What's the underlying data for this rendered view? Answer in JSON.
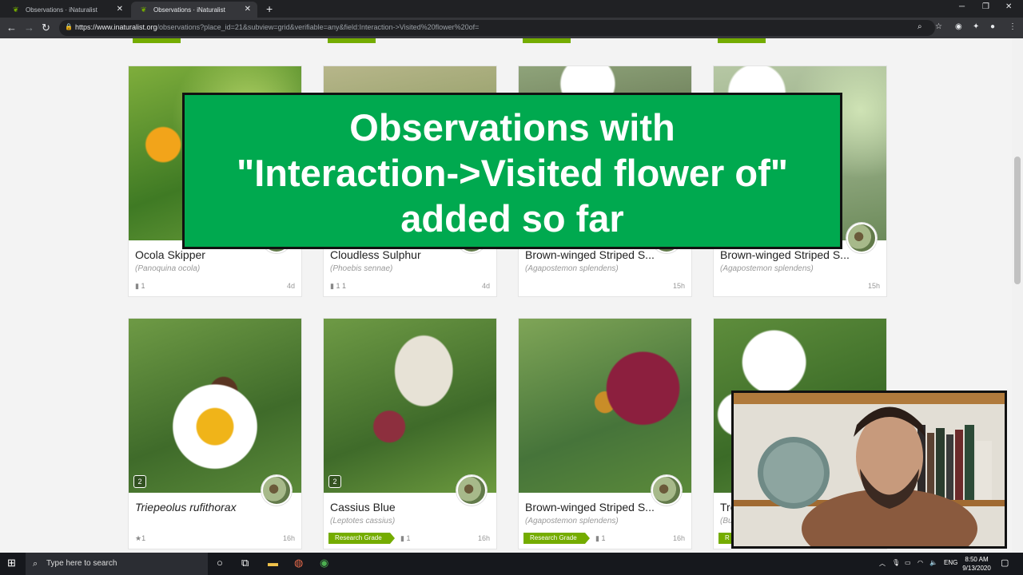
{
  "browser": {
    "tabs": [
      {
        "title": "Observations · iNaturalist",
        "active": false
      },
      {
        "title": "Observations · iNaturalist",
        "active": true
      }
    ],
    "url_host": "https://www.inaturalist.org",
    "url_path": "/observations?place_id=21&subview=grid&verifiable=any&field:Interaction->Visited%20flower%20of="
  },
  "banner": {
    "line1": "Observations with",
    "line2": "\"Interaction->Visited flower of\"",
    "line3": "added so far"
  },
  "cards": [
    {
      "name": "Ocola Skipper",
      "sci": "(Panoquina ocola)",
      "meta": "1",
      "time": "4d"
    },
    {
      "name": "Cloudless Sulphur",
      "sci": "(Phoebis sennae)",
      "meta": "1   1",
      "time": "4d"
    },
    {
      "name": "Brown-winged Striped S...",
      "sci": "(Agapostemon splendens)",
      "meta": "",
      "time": "15h"
    },
    {
      "name": "Brown-winged Striped S...",
      "sci": "(Agapostemon splendens)",
      "meta": "",
      "time": "15h"
    },
    {
      "name": "Triepeolus rufithorax",
      "sci": "",
      "meta": "1",
      "time": "16h",
      "count": "2"
    },
    {
      "name": "Cassius Blue",
      "sci": "(Leptotes cassius)",
      "badge": "Research Grade",
      "meta": "1",
      "time": "16h",
      "count": "2"
    },
    {
      "name": "Brown-winged Striped S...",
      "sci": "(Agapostemon splendens)",
      "badge": "Research Grade",
      "meta": "1",
      "time": "16h"
    },
    {
      "name": "Tro",
      "sci": "(Bu",
      "badge": "R",
      "meta": "",
      "time": ""
    }
  ],
  "taskbar": {
    "search_placeholder": "Type here to search",
    "lang": "ENG",
    "time": "8:50 AM",
    "date": "9/13/2020"
  },
  "colors": {
    "inat_green": "#74ac00",
    "banner_green": "#00a94f"
  }
}
